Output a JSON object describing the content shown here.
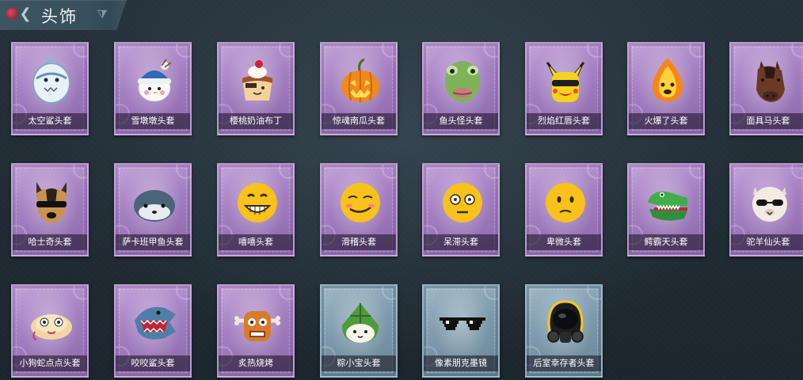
{
  "header": {
    "title": "头饰",
    "back_glyph": "❮",
    "filter_glyph": "⧩"
  },
  "colors": {
    "background": "#1f2a33",
    "card_purple": "#a37ec0",
    "card_blue": "#7e9aac",
    "header_bg": "#3e5562"
  },
  "items": [
    {
      "name": "太空鲨头套",
      "icon": "space-shark-head-icon",
      "rarity": "purple"
    },
    {
      "name": "雪墩墩头套",
      "icon": "snowman-head-icon",
      "rarity": "purple"
    },
    {
      "name": "樱桃奶油布丁",
      "icon": "cherry-pudding-head-icon",
      "rarity": "purple"
    },
    {
      "name": "惊魂南瓜头套",
      "icon": "pumpkin-head-icon",
      "rarity": "purple"
    },
    {
      "name": "鱼头怪头套",
      "icon": "fish-monster-head-icon",
      "rarity": "purple"
    },
    {
      "name": "烈焰红唇头套",
      "icon": "pikachu-lips-head-icon",
      "rarity": "purple"
    },
    {
      "name": "火爆了头套",
      "icon": "fire-head-icon",
      "rarity": "purple"
    },
    {
      "name": "面具马头套",
      "icon": "horse-mask-head-icon",
      "rarity": "purple"
    },
    {
      "name": "哈士奇头套",
      "icon": "husky-head-icon",
      "rarity": "purple"
    },
    {
      "name": "萨卡班甲鱼头套",
      "icon": "sacabambaspis-head-icon",
      "rarity": "purple"
    },
    {
      "name": "嘻嘻头套",
      "icon": "grin-emoji-head-icon",
      "rarity": "purple"
    },
    {
      "name": "滑稽头套",
      "icon": "funny-emoji-head-icon",
      "rarity": "purple"
    },
    {
      "name": "呆滞头套",
      "icon": "dazed-emoji-head-icon",
      "rarity": "purple"
    },
    {
      "name": "卑微头套",
      "icon": "humble-emoji-head-icon",
      "rarity": "purple"
    },
    {
      "name": "鳄霸天头套",
      "icon": "crocodile-head-icon",
      "rarity": "purple"
    },
    {
      "name": "驼羊仙头套",
      "icon": "alpaca-head-icon",
      "rarity": "purple"
    },
    {
      "name": "小狗蛇点点头套",
      "icon": "snake-head-icon",
      "rarity": "purple"
    },
    {
      "name": "咬咬鲨头套",
      "icon": "biting-shark-head-icon",
      "rarity": "purple"
    },
    {
      "name": "炙热烧烤",
      "icon": "barbecue-head-icon",
      "rarity": "purple"
    },
    {
      "name": "粽小宝头套",
      "icon": "zongzi-head-icon",
      "rarity": "blue"
    },
    {
      "name": "像素朋克墨镜",
      "icon": "pixel-sunglasses-icon",
      "rarity": "blue"
    },
    {
      "name": "后室幸存者头套",
      "icon": "gas-mask-helmet-icon",
      "rarity": "blue"
    }
  ]
}
